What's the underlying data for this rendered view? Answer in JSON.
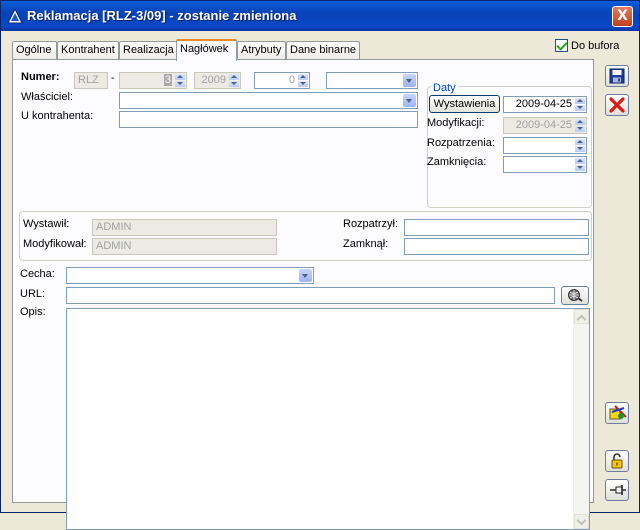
{
  "window": {
    "title": "Reklamacja  [RLZ-3/09] - zostanie zmieniona",
    "close_label": "X"
  },
  "tabs": [
    {
      "label": "Ogólne",
      "active": false
    },
    {
      "label": "Kontrahent",
      "active": false
    },
    {
      "label": "Realizacja",
      "active": false
    },
    {
      "label": "Nagłówek",
      "active": true
    },
    {
      "label": "Atrybuty",
      "active": false
    },
    {
      "label": "Dane binarne",
      "active": false
    }
  ],
  "do_bufora": {
    "label": "Do bufora",
    "checked": true
  },
  "header": {
    "numer_label": "Numer:",
    "numer_series": "RLZ",
    "numer_sep": "-",
    "numer_value": "3",
    "numer_year": "2009",
    "numer_extra": "0",
    "numer_suffix": "",
    "wlasciciel_label": "Właściciel:",
    "wlasciciel_value": "",
    "u_kontrahenta_label": "U kontrahenta:",
    "u_kontrahenta_value": ""
  },
  "daty": {
    "caption": "Daty",
    "wystawienia_button": "Wystawienia",
    "wystawienia_value": "2009-04-25",
    "modyfikacji_label": "Modyfikacji:",
    "modyfikacji_value": "2009-04-25",
    "rozpatrzenia_label": "Rozpatrzenia:",
    "rozpatrzenia_value": "",
    "zamkniecia_label": "Zamknięcia:",
    "zamkniecia_value": ""
  },
  "operators": {
    "wystawil_label": "Wystawił:",
    "wystawil_value": "ADMIN",
    "modyfikowal_label": "Modyfikował:",
    "modyfikowal_value": "ADMIN",
    "rozpatrzyl_label": "Rozpatrzył:",
    "rozpatrzyl_value": "",
    "zamknal_label": "Zamknął:",
    "zamknal_value": ""
  },
  "cecha": {
    "label": "Cecha:",
    "value": ""
  },
  "url": {
    "label": "URL:",
    "value": ""
  },
  "opis": {
    "label": "Opis:",
    "value": ""
  },
  "colors": {
    "title_bar": "#0842b8",
    "tab_highlight": "#e68b2c",
    "group_caption": "#0046d5"
  },
  "side_icons": [
    "save-icon",
    "cancel-icon",
    "attributes-icon",
    "lock-icon",
    "pin-icon"
  ]
}
